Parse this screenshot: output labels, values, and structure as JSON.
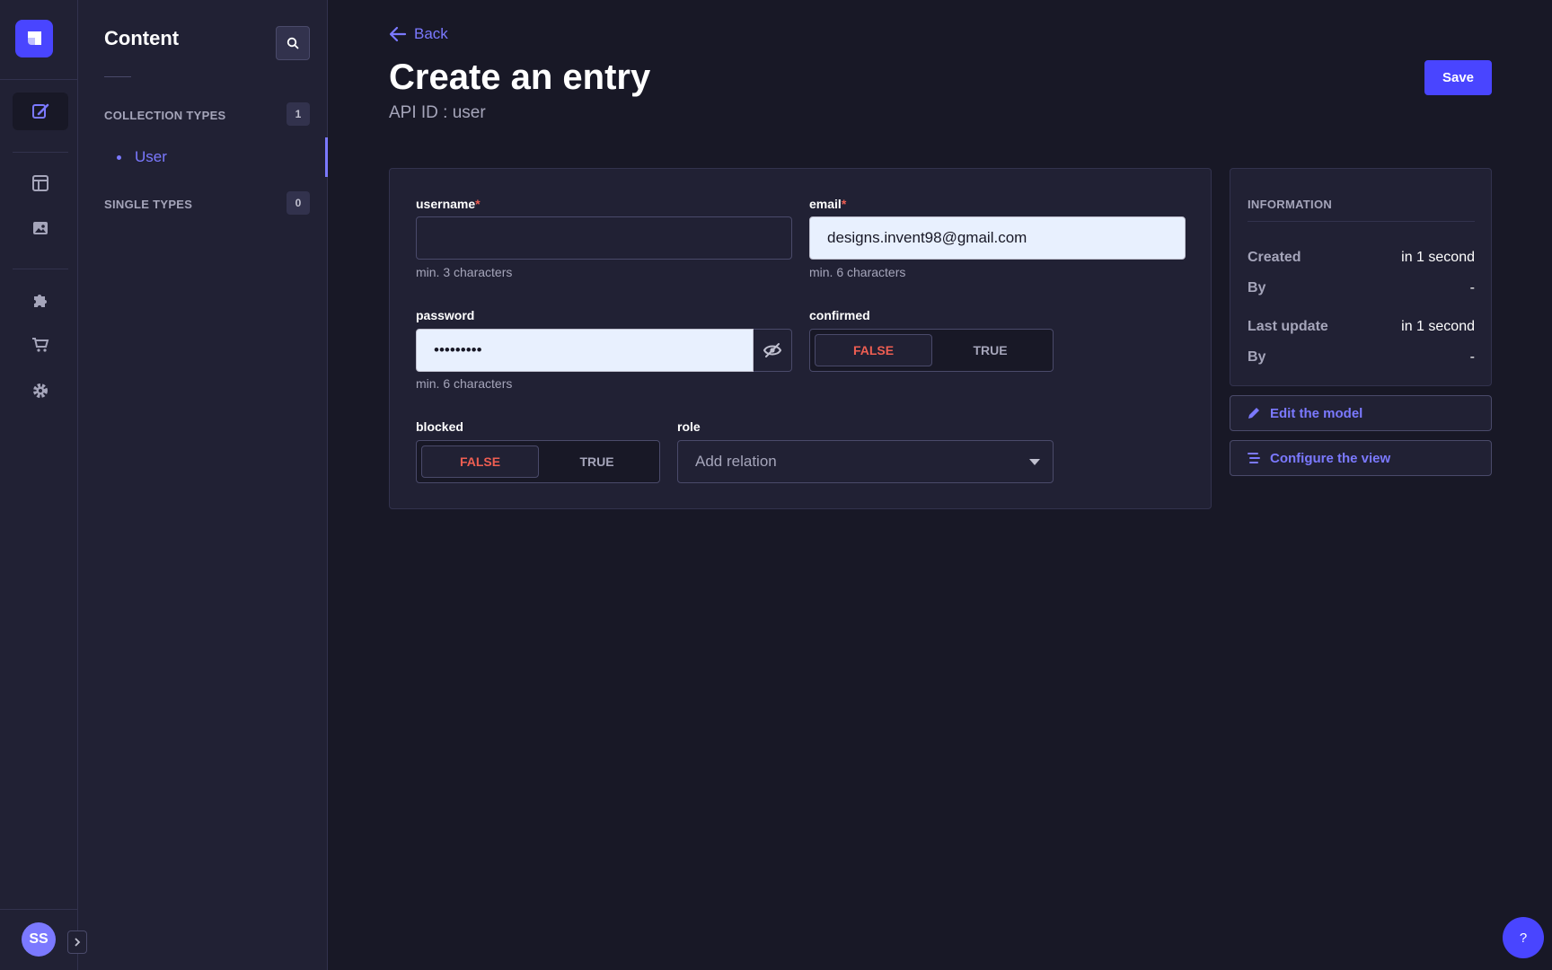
{
  "nav": {
    "items": [
      {
        "icon": "feather-pen-icon",
        "active": true
      },
      {
        "icon": "layout-icon",
        "active": false
      },
      {
        "icon": "image-icon",
        "active": false
      },
      {
        "icon": "puzzle-icon",
        "active": false
      },
      {
        "icon": "cart-icon",
        "active": false
      },
      {
        "icon": "gear-icon",
        "active": false
      }
    ],
    "avatar_initials": "SS"
  },
  "sidebar": {
    "title": "Content",
    "collection_types_label": "COLLECTION TYPES",
    "collection_types_count": "1",
    "collection_items": [
      "User"
    ],
    "single_types_label": "SINGLE TYPES",
    "single_types_count": "0"
  },
  "header": {
    "back_label": "Back",
    "title": "Create an entry",
    "api_id": "API ID : user",
    "save_label": "Save"
  },
  "form": {
    "username": {
      "label": "username",
      "required_mark": "*",
      "value": "",
      "hint": "min. 3 characters"
    },
    "email": {
      "label": "email",
      "required_mark": "*",
      "value": "designs.invent98@gmail.com",
      "hint": "min. 6 characters"
    },
    "password": {
      "label": "password",
      "value": "•••••••••",
      "hint": "min. 6 characters"
    },
    "confirmed": {
      "label": "confirmed",
      "false_label": "FALSE",
      "true_label": "TRUE",
      "selected": "FALSE"
    },
    "blocked": {
      "label": "blocked",
      "false_label": "FALSE",
      "true_label": "TRUE",
      "selected": "FALSE"
    },
    "role": {
      "label": "role",
      "placeholder": "Add relation"
    }
  },
  "information": {
    "heading": "INFORMATION",
    "created_label": "Created",
    "created_value": "in 1 second",
    "created_by_label": "By",
    "created_by_value": "-",
    "updated_label": "Last update",
    "updated_value": "in 1 second",
    "updated_by_label": "By",
    "updated_by_value": "-"
  },
  "actions": {
    "edit_model_label": "Edit the model",
    "configure_view_label": "Configure the view"
  },
  "help_label": "?",
  "colors": {
    "background": "#181826",
    "panel": "#212134",
    "border": "#4a4a6a",
    "primary": "#4945ff",
    "accent": "#7b79ff",
    "danger": "#ee5e52"
  }
}
